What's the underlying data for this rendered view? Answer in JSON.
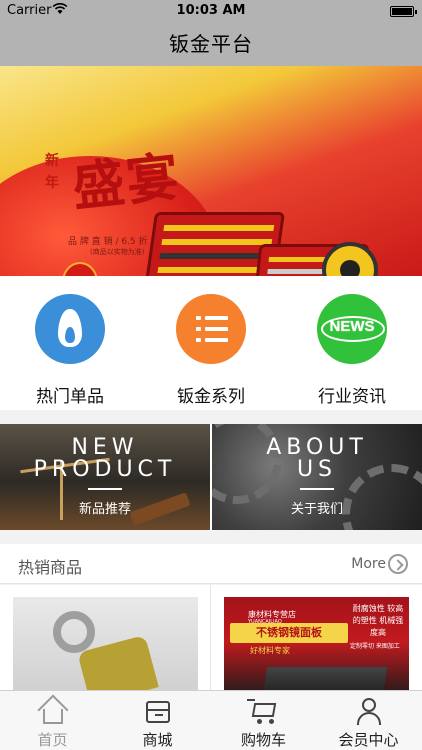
{
  "status_bar": {
    "carrier": "Carrier",
    "time": "10:03 AM",
    "battery_level": 1.0
  },
  "nav": {
    "title": "钣金平台"
  },
  "banner": {
    "seal_text": "新年",
    "headline": "盛宴",
    "subline": "品 牌 直 销 / 6.5 折 / 包 邮",
    "subline2": "(商品以实物为准)"
  },
  "categories": [
    {
      "label": "热门单品",
      "icon": "flame-icon",
      "color": "#3b8fd8"
    },
    {
      "label": "钣金系列",
      "icon": "list-icon",
      "color": "#f5802e"
    },
    {
      "label": "行业资讯",
      "icon": "news-icon",
      "color": "#32c13a",
      "badge": "NEWS"
    }
  ],
  "promos": [
    {
      "line1": "NEW",
      "line2": "PRODUCT",
      "sub": "新品推荐"
    },
    {
      "line1": "ABOUT",
      "line2": "US",
      "sub": "关于我们"
    }
  ],
  "hot_section": {
    "title": "热销商品",
    "more_label": "More"
  },
  "products": [
    {
      "name": "clamp"
    },
    {
      "shop": "康材料专营店",
      "brand_small": "YUANCAILIAO",
      "banner": "不锈钢镜面板",
      "sub": "好材料专家",
      "side": "耐腐蚀性 较高的塑性 机械强度高",
      "tags": "定制零切  来图加工"
    }
  ],
  "tabs": [
    {
      "label": "首页",
      "icon": "home-icon",
      "active": false
    },
    {
      "label": "商城",
      "icon": "shop-icon",
      "active": true
    },
    {
      "label": "购物车",
      "icon": "cart-icon",
      "active": false
    },
    {
      "label": "会员中心",
      "icon": "user-icon",
      "active": false
    }
  ]
}
